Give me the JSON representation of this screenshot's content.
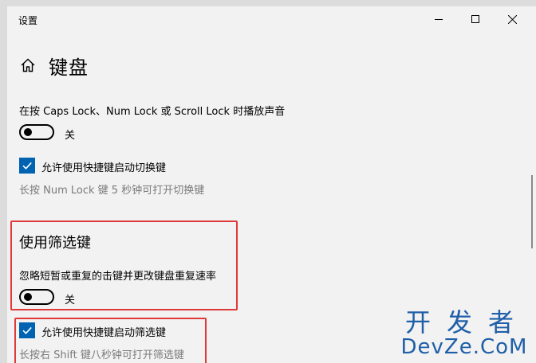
{
  "window": {
    "title": "设置"
  },
  "header": {
    "title": "键盘"
  },
  "sound": {
    "label": "在按 Caps Lock、Num Lock 或 Scroll Lock 时播放声音",
    "toggle_state": "关"
  },
  "toggle_shortcut": {
    "checkbox_label": "允许使用快捷键启动切换键",
    "hint": "长按 Num Lock 键 5 秒钟可打开切换键"
  },
  "filter_keys": {
    "title": "使用筛选键",
    "description": "忽略短暂或重复的击键并更改键盘重复速率",
    "toggle_state": "关",
    "checkbox_label": "允许使用快捷键启动筛选键",
    "hint": "长按右 Shift 键八秒钟可打开筛选键"
  },
  "watermark": {
    "cn": "开发者",
    "en": "DevZe.CoM"
  },
  "colors": {
    "accent": "#0063b1",
    "highlight": "#e0393a",
    "watermark": "#1f5fa8"
  }
}
